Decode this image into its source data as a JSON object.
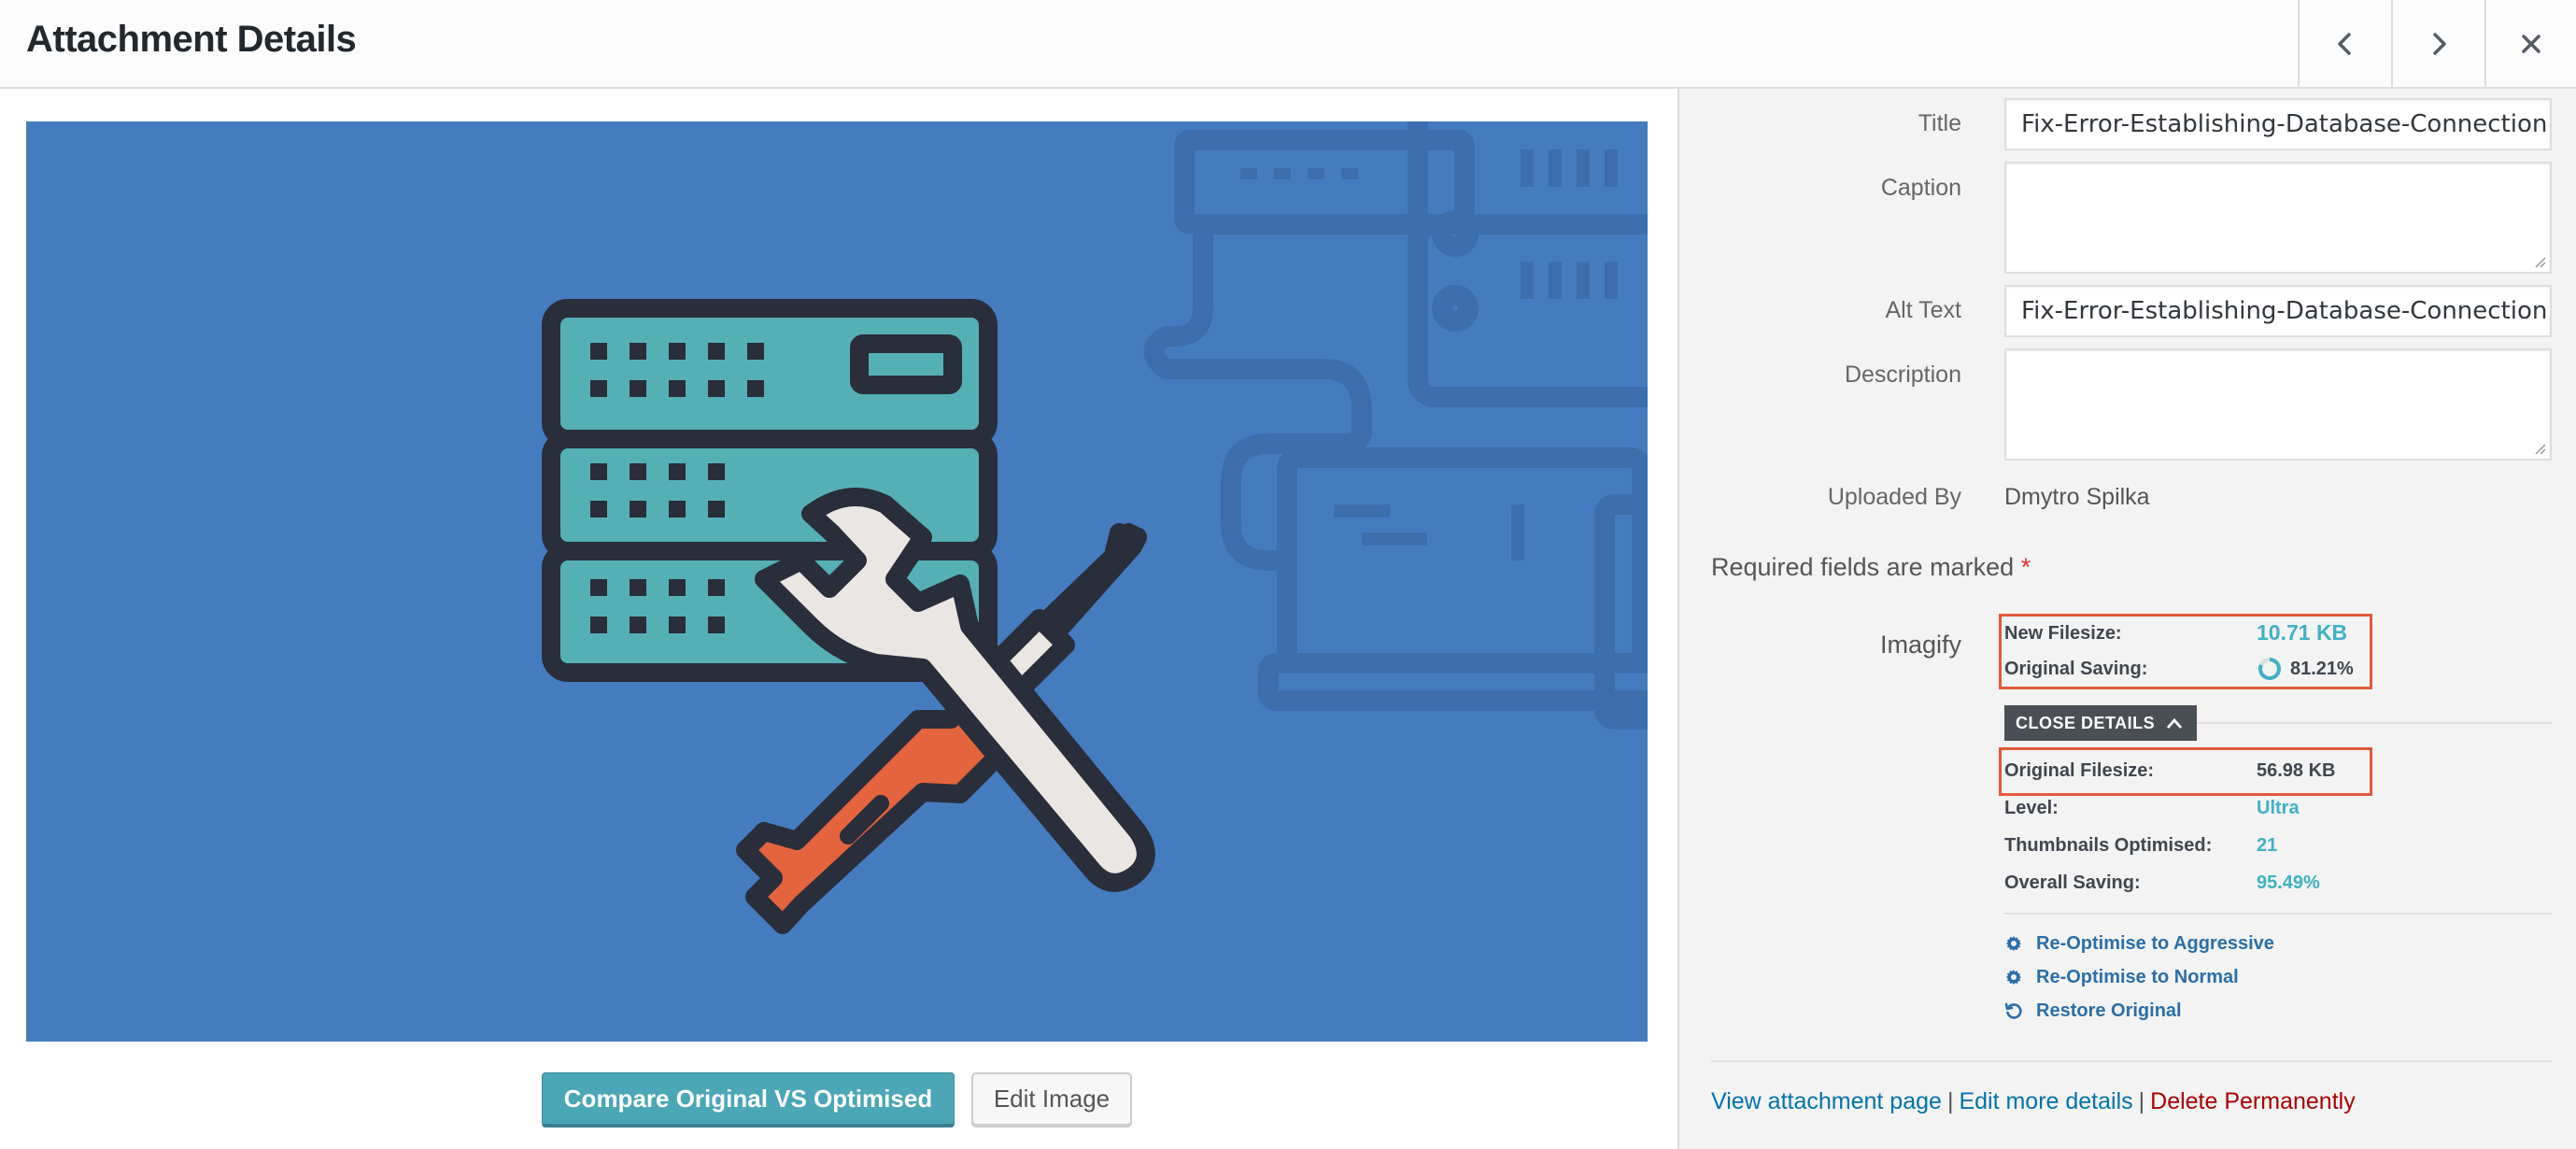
{
  "header": {
    "title": "Attachment Details",
    "prev_icon": "chevron-left-icon",
    "next_icon": "chevron-right-icon",
    "close_icon": "close-icon"
  },
  "preview": {
    "background_color": "#457cc0",
    "compare_label": "Compare Original VS Optimised",
    "edit_label": "Edit Image"
  },
  "details": {
    "title_label": "Title",
    "title_value": "Fix-Error-Establishing-Database-Connection",
    "caption_label": "Caption",
    "caption_value": "",
    "alt_label": "Alt Text",
    "alt_value": "Fix-Error-Establishing-Database-Connection",
    "description_label": "Description",
    "description_value": "",
    "uploaded_by_label": "Uploaded By",
    "uploaded_by_value": "Dmytro Spilka",
    "required_text": "Required fields are marked",
    "required_star": "*"
  },
  "imagify": {
    "label": "Imagify",
    "new_filesize_label": "New Filesize:",
    "new_filesize_value": "10.71 KB",
    "original_saving_label": "Original Saving:",
    "original_saving_value": "81.21%",
    "original_saving_fraction": 0.8121,
    "close_details_label": "CLOSE DETAILS",
    "original_filesize_label": "Original Filesize:",
    "original_filesize_value": "56.98 KB",
    "level_label": "Level:",
    "level_value": "Ultra",
    "thumbnails_label": "Thumbnails Optimised:",
    "thumbnails_value": "21",
    "overall_saving_label": "Overall Saving:",
    "overall_saving_value": "95.49%",
    "actions": [
      {
        "label": "Re-Optimise to Aggressive",
        "icon": "gear-icon"
      },
      {
        "label": "Re-Optimise to Normal",
        "icon": "gear-icon"
      },
      {
        "label": "Restore Original",
        "icon": "restore-icon"
      }
    ],
    "highlight_color": "#e05a3a",
    "accent_color": "#40b1c4"
  },
  "footer": {
    "view_page": "View attachment page",
    "edit_more": "Edit more details",
    "delete": "Delete Permanently",
    "separator": "|"
  }
}
